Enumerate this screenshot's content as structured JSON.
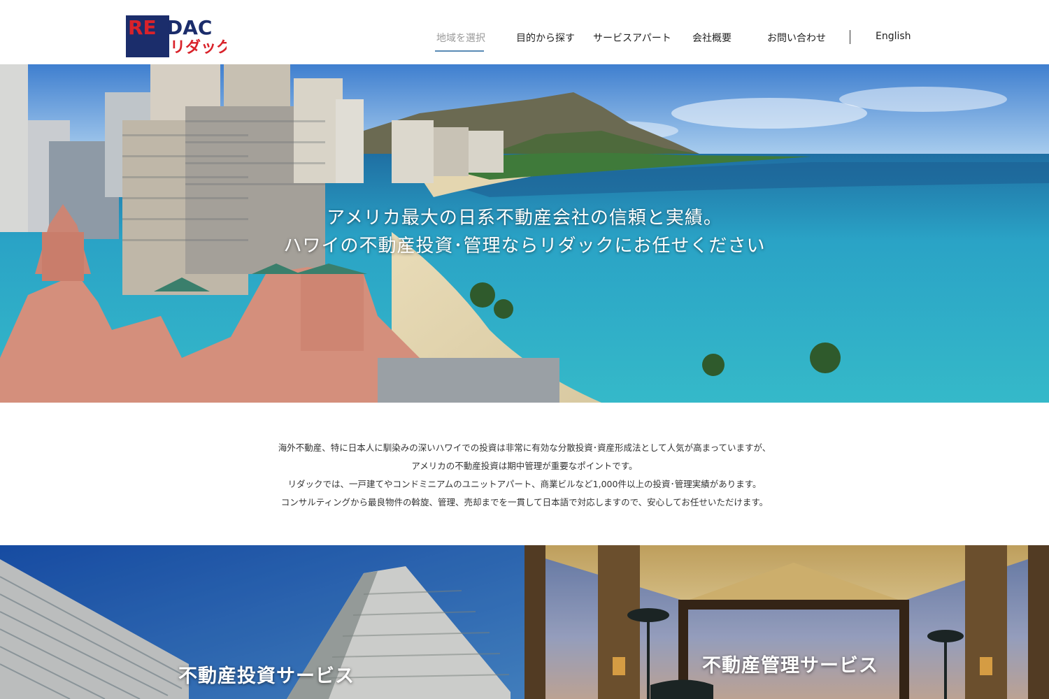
{
  "logo": {
    "top_text_left": "RE",
    "top_text_right": "DAC",
    "kana": "リダック",
    "alt": "REDAC リダック"
  },
  "nav": {
    "items": [
      {
        "label": "地域を選択",
        "active": true
      },
      {
        "label": "目的から探す",
        "active": false
      },
      {
        "label": "サービスアパート",
        "active": false
      },
      {
        "label": "会社概要",
        "active": false
      },
      {
        "label": "お問い合わせ",
        "active": false
      },
      {
        "label": "English",
        "active": false
      }
    ]
  },
  "hero": {
    "line1": "アメリカ最大の日系不動産会社の信頼と実績。",
    "line2": "ハワイの不動産投資･管理ならリダックにお任せください"
  },
  "intro": {
    "lines": [
      "海外不動産、特に日本人に馴染みの深いハワイでの投資は非常に有効な分散投資･資産形成法として人気が高まっていますが、",
      "アメリカの不動産投資は期中管理が重要なポイントです。",
      "リダックでは、一戸建てやコンドミニアムのユニットアパート、商業ビルなど1,000件以上の投資･管理実績があります。",
      "コンサルティングから最良物件の斡旋、管理、売却までを一貫して日本語で対応しますので、安心してお任せいただけます。"
    ]
  },
  "services": {
    "investment": {
      "title": "不動産投資サービス"
    },
    "management": {
      "title": "不動産管理サービス"
    }
  },
  "colors": {
    "logo_navy": "#1b2d6b",
    "logo_red": "#d9222a",
    "nav_active": "#9a9a9a",
    "nav_underline": "#5a8bb5",
    "ocean": "#2fa7c4",
    "sky": "#4a8fd6"
  }
}
